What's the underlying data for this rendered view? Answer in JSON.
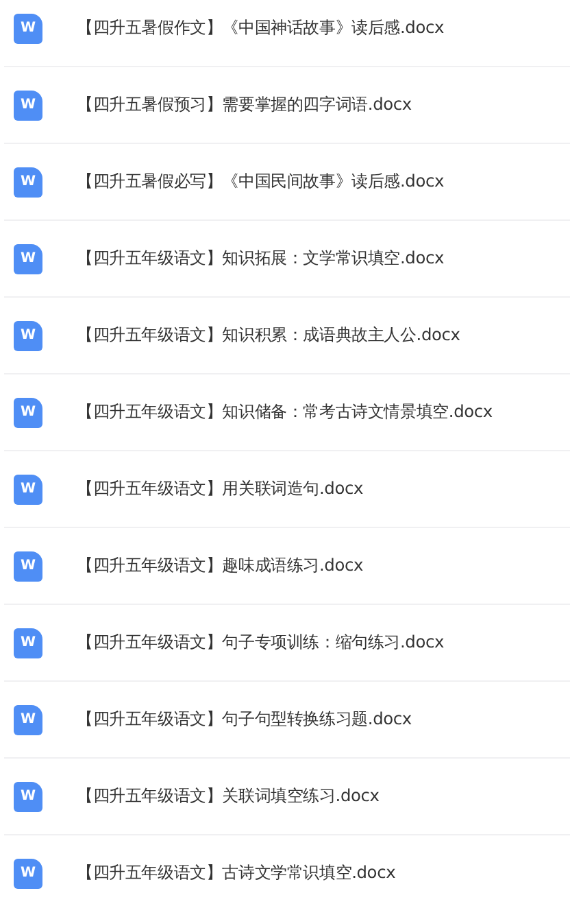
{
  "files": [
    {
      "icon_text": "W",
      "name": "【四升五暑假作文】《中国神话故事》读后感.docx"
    },
    {
      "icon_text": "W",
      "name": "【四升五暑假预习】需要掌握的四字词语.docx"
    },
    {
      "icon_text": "W",
      "name": "【四升五暑假必写】《中国民间故事》读后感.docx"
    },
    {
      "icon_text": "W",
      "name": "【四升五年级语文】知识拓展：文学常识填空.docx"
    },
    {
      "icon_text": "W",
      "name": "【四升五年级语文】知识积累：成语典故主人公.docx"
    },
    {
      "icon_text": "W",
      "name": "【四升五年级语文】知识储备：常考古诗文情景填空.docx"
    },
    {
      "icon_text": "W",
      "name": "【四升五年级语文】用关联词造句.docx"
    },
    {
      "icon_text": "W",
      "name": "【四升五年级语文】趣味成语练习.docx"
    },
    {
      "icon_text": "W",
      "name": "【四升五年级语文】句子专项训练：缩句练习.docx"
    },
    {
      "icon_text": "W",
      "name": "【四升五年级语文】句子句型转换练习题.docx"
    },
    {
      "icon_text": "W",
      "name": "【四升五年级语文】关联词填空练习.docx"
    },
    {
      "icon_text": "W",
      "name": "【四升五年级语文】古诗文学常识填空.docx"
    }
  ]
}
